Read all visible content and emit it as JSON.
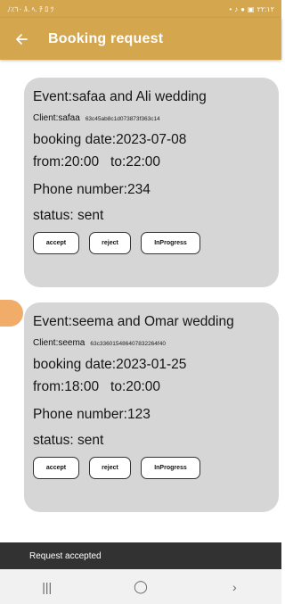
{
  "status_bar": {
    "left_text": "ﾉ٪٦٠ ﾙ. ﾍ. ﾁ ﾛ ﾂ",
    "right_text": "۲۲:۱۲"
  },
  "appbar": {
    "back_icon": "arrow-left-icon",
    "title": "Booking request"
  },
  "bookings": [
    {
      "event": "Event:safaa and Ali wedding",
      "client_name": "Client:safaa",
      "client_id": "63c45ab8c1d073873f363c14",
      "booking_date": "booking date:2023-07-08",
      "time": "from:20:00   to:22:00",
      "phone": "Phone number:234",
      "status": "status: sent",
      "buttons": {
        "accept": "accept",
        "reject": "reject",
        "inprogress": "InProgress"
      }
    },
    {
      "event": "Event:seema and Omar wedding",
      "client_name": "Client:seema",
      "client_id": "63c336015486407832264f40",
      "booking_date": "booking date:2023-01-25",
      "time": "from:18:00   to:20:00",
      "phone": "Phone number:123",
      "status": "status: sent",
      "buttons": {
        "accept": "accept",
        "reject": "reject",
        "inprogress": "InProgress"
      }
    }
  ],
  "snackbar": {
    "message": "Request accepted"
  },
  "nav": {
    "recents": "|||",
    "home": "◯",
    "back": "›"
  },
  "colors": {
    "appbar": "#d4a64e",
    "card": "#d6d6d6",
    "snackbar": "#323232"
  }
}
